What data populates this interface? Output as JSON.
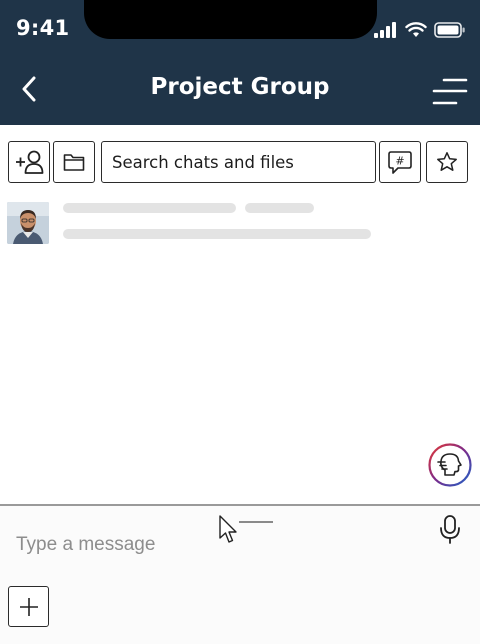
{
  "status_bar": {
    "time": "9:41",
    "icons": [
      "signal-icon",
      "wifi-icon",
      "battery-icon"
    ]
  },
  "header": {
    "title": "Project Group",
    "back_icon": "chevron-left-icon",
    "menu_icon": "menu-icon",
    "background": "#1f3448"
  },
  "toolbar": {
    "add_member_icon": "add-person-icon",
    "folder_icon": "folder-icon",
    "search_value": "Search chats and files",
    "hashtag_icon": "hashtag-chat-icon",
    "star_icon": "star-icon"
  },
  "chat_list": {
    "items": [
      {
        "avatar": "avatar-photo"
      }
    ]
  },
  "floating_button": {
    "icon": "speech-head-icon"
  },
  "compose": {
    "placeholder": "Type a message",
    "mic_icon": "microphone-icon",
    "plus_icon": "plus-icon"
  }
}
